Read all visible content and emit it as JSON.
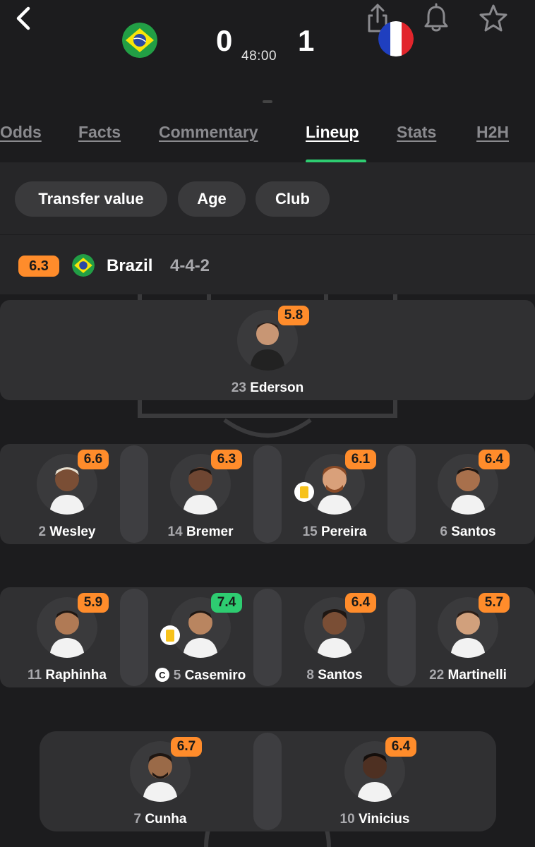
{
  "header": {
    "home_score": "0",
    "away_score": "1",
    "match_time": "48:00"
  },
  "tabs": [
    {
      "label": "Odds"
    },
    {
      "label": "Facts"
    },
    {
      "label": "Commentary"
    },
    {
      "label": "Lineup",
      "active": true
    },
    {
      "label": "Stats"
    },
    {
      "label": "H2H"
    }
  ],
  "filters": [
    {
      "label": "Transfer value"
    },
    {
      "label": "Age"
    },
    {
      "label": "Club"
    }
  ],
  "team": {
    "rating": "6.3",
    "name": "Brazil",
    "formation": "4-4-2"
  },
  "players": {
    "gk": {
      "number": "23",
      "name": "Ederson",
      "rating": "5.8"
    },
    "def": [
      {
        "number": "2",
        "name": "Wesley",
        "rating": "6.6"
      },
      {
        "number": "14",
        "name": "Bremer",
        "rating": "6.3"
      },
      {
        "number": "15",
        "name": "Pereira",
        "rating": "6.1"
      },
      {
        "number": "6",
        "name": "Santos",
        "rating": "6.4"
      }
    ],
    "mid": [
      {
        "number": "11",
        "name": "Raphinha",
        "rating": "5.9"
      },
      {
        "number": "5",
        "name": "Casemiro",
        "rating": "7.4"
      },
      {
        "number": "8",
        "name": "Santos",
        "rating": "6.4"
      },
      {
        "number": "22",
        "name": "Martinelli",
        "rating": "5.7"
      }
    ],
    "fwd": [
      {
        "number": "7",
        "name": "Cunha",
        "rating": "6.7"
      },
      {
        "number": "10",
        "name": "Vinicius",
        "rating": "6.4"
      }
    ]
  },
  "colors": {
    "rating_default": "#ff8c2b",
    "rating_high": "#2ecc71",
    "active_tab_indicator": "#2ecc71",
    "background": "#1c1c1e"
  }
}
